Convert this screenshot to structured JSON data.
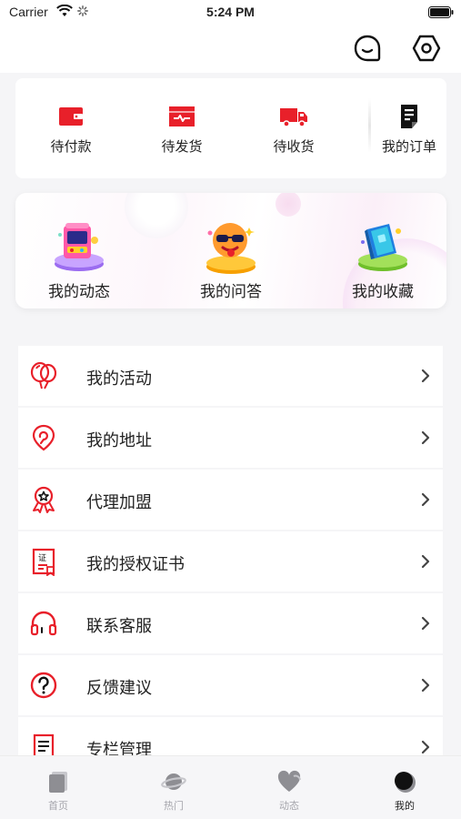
{
  "status_bar": {
    "carrier": "Carrier",
    "time": "5:24 PM"
  },
  "header": {
    "icons": [
      "message-icon",
      "settings-icon"
    ]
  },
  "orders": [
    {
      "label": "待付款",
      "icon": "wallet-icon",
      "color": "#e8202a"
    },
    {
      "label": "待发货",
      "icon": "package-icon",
      "color": "#e8202a"
    },
    {
      "label": "待收货",
      "icon": "truck-icon",
      "color": "#e8202a"
    },
    {
      "label": "我的订单",
      "icon": "order-list-icon",
      "color": "#111111"
    }
  ],
  "features": [
    {
      "label": "我的动态",
      "icon": "arcade-3d-icon"
    },
    {
      "label": "我的问答",
      "icon": "cool-face-3d-icon"
    },
    {
      "label": "我的收藏",
      "icon": "book-3d-icon"
    }
  ],
  "menu": [
    {
      "label": "我的活动",
      "icon": "balloon-icon"
    },
    {
      "label": "我的地址",
      "icon": "location-pin-icon"
    },
    {
      "label": "代理加盟",
      "icon": "award-badge-icon"
    },
    {
      "label": "我的授权证书",
      "icon": "certificate-icon"
    },
    {
      "label": "联系客服",
      "icon": "headset-icon"
    },
    {
      "label": "反馈建议",
      "icon": "question-circle-icon"
    },
    {
      "label": "专栏管理",
      "icon": "column-doc-icon"
    }
  ],
  "tabs": [
    {
      "label": "首页",
      "icon": "home-tab-icon",
      "active": false
    },
    {
      "label": "热门",
      "icon": "planet-tab-icon",
      "active": false
    },
    {
      "label": "动态",
      "icon": "heart-tab-icon",
      "active": false
    },
    {
      "label": "我的",
      "icon": "profile-tab-icon",
      "active": true
    }
  ],
  "colors": {
    "accent_red": "#e8202a",
    "tab_inactive": "#a6a6ac",
    "tab_active": "#222222"
  }
}
